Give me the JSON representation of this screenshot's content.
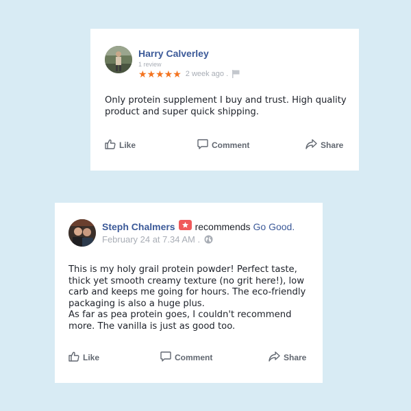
{
  "review": {
    "author": "Harry Calverley",
    "review_count": "1 review",
    "stars": "★★★★★",
    "time_ago": "2 week ago .",
    "text": "Only protein supplement I buy and trust. High quality product and super quick shipping.",
    "actions": {
      "like": "Like",
      "comment": "Comment",
      "share": "Share"
    }
  },
  "recommendation": {
    "author": "Steph Chalmers",
    "verb": "recommends",
    "page": "Go Good.",
    "date": "February 24 at 7.34 AM .",
    "paragraph1": "This is my holy grail protein powder! Perfect taste, thick yet smooth creamy texture (no grit here!), low carb and keeps me going for hours. The eco-friendly packaging is also a huge plus.",
    "paragraph2": "As far as pea protein goes, I couldn't recommend more. The vanilla is just as good too.",
    "actions": {
      "like": "Like",
      "comment": "Comment",
      "share": "Share"
    }
  },
  "colors": {
    "background": "#d8ebf4",
    "name": "#3b5998",
    "stars": "#f3731f",
    "badge": "#f05a5b",
    "muted": "#a8adb5",
    "action": "#616770"
  },
  "icons": [
    "avatar",
    "star-rating",
    "flag-icon",
    "recommend-badge-icon",
    "globe-icon",
    "like-icon",
    "comment-icon",
    "share-icon"
  ]
}
